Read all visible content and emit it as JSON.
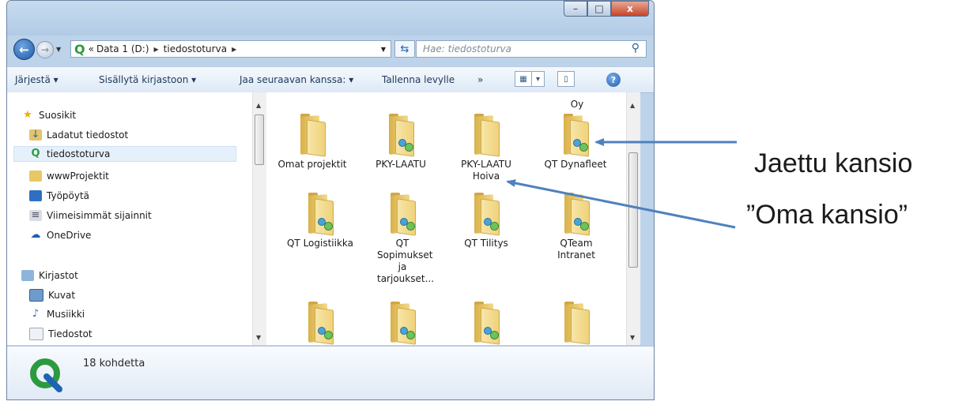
{
  "window": {
    "controls": {
      "minimize": "–",
      "maximize": "□",
      "close": "x"
    }
  },
  "address": {
    "overflow": "«",
    "crumbs": [
      "Data 1 (D:)",
      "tiedostoturva"
    ],
    "search_placeholder": "Hae: tiedostoturva"
  },
  "toolbar": {
    "organize": "Järjestä ▾",
    "include_library": "Sisällytä kirjastoon ▾",
    "share_with": "Jaa seuraavan kanssa: ▾",
    "burn": "Tallenna levylle",
    "more": "»"
  },
  "nav": {
    "favorites": "Suosikit",
    "downloads": "Ladatut tiedostot",
    "current": "tiedostoturva",
    "www": "wwwProjektit",
    "desktop": "Työpöytä",
    "recent": "Viimeisimmät sijainnit",
    "onedrive": "OneDrive",
    "libraries": "Kirjastot",
    "pictures": "Kuvat",
    "music": "Musiikki",
    "documents": "Tiedostot"
  },
  "items": [
    {
      "label": "Omat projektit",
      "shared": false
    },
    {
      "label": "PKY-LAATU",
      "shared": true
    },
    {
      "label": "PKY-LAATU Hoiva",
      "shared": false
    },
    {
      "label": "QT Dynafleet",
      "shared": true
    },
    {
      "label": "QT Logistiikka",
      "shared": true
    },
    {
      "label": "QT Sopimukset ja tarjoukset...",
      "shared": true
    },
    {
      "label": "QT Tilitys",
      "shared": true
    },
    {
      "label": "QTeam Intranet",
      "shared": true
    }
  ],
  "content_partial_label": "Oy",
  "status": {
    "count_text": "18 kohdetta"
  },
  "annotations": {
    "shared_folder": "Jaettu kansio",
    "own_folder": "”Oma kansio”"
  },
  "colors": {
    "arrow": "#4f81bd",
    "share_icon": "#2f9c3e"
  }
}
